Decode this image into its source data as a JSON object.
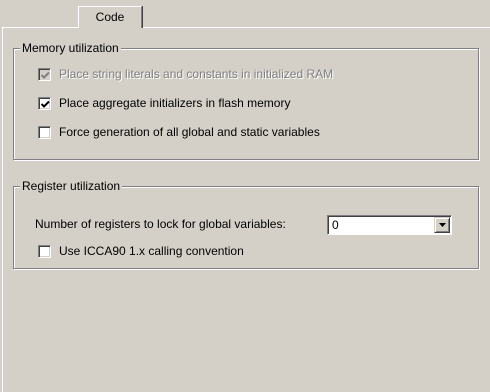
{
  "tab": {
    "label": "Code"
  },
  "memory": {
    "title": "Memory utilization",
    "options": [
      {
        "label": "Place string literals and constants in initialized RAM",
        "checked": true,
        "enabled": false
      },
      {
        "label": "Place aggregate initializers in flash memory",
        "checked": true,
        "enabled": true
      },
      {
        "label": "Force generation of all global and static variables",
        "checked": false,
        "enabled": true
      }
    ]
  },
  "register": {
    "title": "Register utilization",
    "lock_label": "Number of registers to lock for global variables:",
    "lock_value": "0",
    "calling_convention": {
      "label": "Use ICCA90 1.x calling convention",
      "checked": false,
      "enabled": true
    }
  },
  "icons": {
    "check": "check-icon",
    "dropdown": "dropdown-arrow-icon"
  },
  "colors": {
    "face": "#d4d0c8",
    "shadow": "#808080",
    "highlight": "#ffffff",
    "disabled_text": "#808080"
  }
}
